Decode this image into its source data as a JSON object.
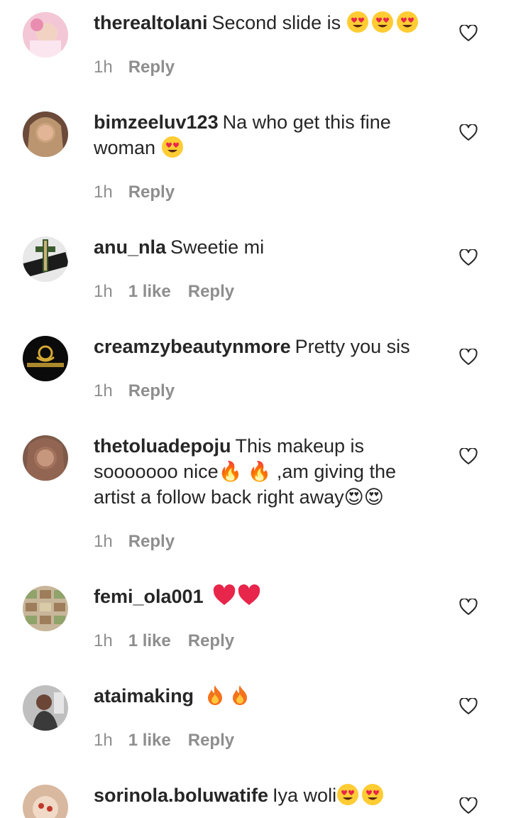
{
  "comments": [
    {
      "username": "therealtolani",
      "text": "Second slide is",
      "emojis": [
        "heart-eyes",
        "heart-eyes",
        "heart-eyes"
      ],
      "time": "1h",
      "likes": "",
      "reply": "Reply",
      "avatar_color": "#f3c7d6"
    },
    {
      "username": "bimzeeluv123",
      "text": "Na who get this fine woman",
      "emojis": [
        "heart-eyes"
      ],
      "time": "1h",
      "likes": "",
      "reply": "Reply",
      "avatar_color": "#c9a27a"
    },
    {
      "username": "anu_nla",
      "text": "Sweetie mi",
      "emojis": [],
      "time": "1h",
      "likes": "1 like",
      "reply": "Reply",
      "avatar_color": "#2f3b2a"
    },
    {
      "username": "creamzybeautynmore",
      "text": "Pretty you sis",
      "emojis": [],
      "time": "1h",
      "likes": "",
      "reply": "Reply",
      "avatar_color": "#0b0b0b"
    },
    {
      "username": "thetoluadepoju",
      "text": "This makeup is sooooooo nice🔥 🔥 ,am giving the artist a follow back right away😍😍",
      "emojis": [],
      "time": "1h",
      "likes": "",
      "reply": "Reply",
      "avatar_color": "#9a6a55"
    },
    {
      "username": "femi_ola001",
      "text": "",
      "emojis": [
        "red-heart",
        "red-heart"
      ],
      "time": "1h",
      "likes": "1 like",
      "reply": "Reply",
      "avatar_color": "#b59b7c"
    },
    {
      "username": "ataimaking",
      "text": "",
      "emojis": [
        "fire",
        "fire"
      ],
      "time": "1h",
      "likes": "1 like",
      "reply": "Reply",
      "avatar_color": "#a7a7a7"
    },
    {
      "username": "sorinola.boluwatife",
      "text": "Iya woli",
      "emojis": [
        "heart-eyes",
        "heart-eyes"
      ],
      "time": "",
      "likes": "",
      "reply": "",
      "avatar_color": "#d9b8a0"
    }
  ],
  "colors": {
    "text": "#262626",
    "secondary": "#8e8e8e",
    "emoji_face": "#ffcc33",
    "emoji_heart": "#e8254a",
    "fire": "#f5731c"
  }
}
